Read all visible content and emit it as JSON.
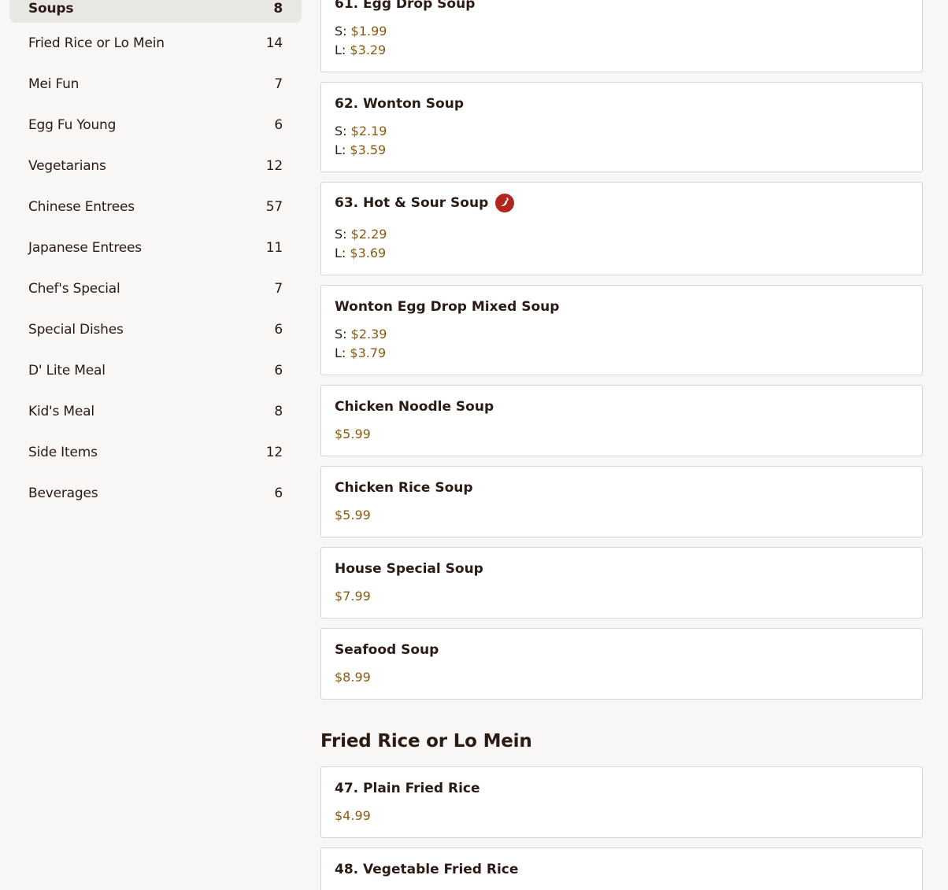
{
  "sidebar": {
    "items": [
      {
        "label": "Soups",
        "count": "8"
      },
      {
        "label": "Fried Rice or Lo Mein",
        "count": "14"
      },
      {
        "label": "Mei Fun",
        "count": "7"
      },
      {
        "label": "Egg Fu Young",
        "count": "6"
      },
      {
        "label": "Vegetarians",
        "count": "12"
      },
      {
        "label": "Chinese Entrees",
        "count": "57"
      },
      {
        "label": "Japanese Entrees",
        "count": "11"
      },
      {
        "label": "Chef's Special",
        "count": "7"
      },
      {
        "label": "Special Dishes",
        "count": "6"
      },
      {
        "label": "D' Lite Meal",
        "count": "6"
      },
      {
        "label": "Kid's Meal",
        "count": "8"
      },
      {
        "label": "Side Items",
        "count": "12"
      },
      {
        "label": "Beverages",
        "count": "6"
      }
    ]
  },
  "soups": {
    "items": [
      {
        "name": "61. Egg Drop Soup",
        "small_label": "S:",
        "small": "$1.99",
        "large_label": "L:",
        "large": "$3.29"
      },
      {
        "name": "62. Wonton Soup",
        "small_label": "S:",
        "small": "$2.19",
        "large_label": "L:",
        "large": "$3.59"
      },
      {
        "name": "63. Hot & Sour Soup",
        "spicy_icon": "chili-pepper-icon",
        "small_label": "S:",
        "small": "$2.29",
        "large_label": "L:",
        "large": "$3.69"
      },
      {
        "name": "Wonton Egg Drop Mixed Soup",
        "small_label": "S:",
        "small": "$2.39",
        "large_label": "L:",
        "large": "$3.79"
      },
      {
        "name": "Chicken Noodle Soup",
        "price": "$5.99"
      },
      {
        "name": "Chicken Rice Soup",
        "price": "$5.99"
      },
      {
        "name": "House Special Soup",
        "price": "$7.99"
      },
      {
        "name": "Seafood Soup",
        "price": "$8.99"
      }
    ]
  },
  "fried_rice": {
    "title": "Fried Rice or Lo Mein",
    "items": [
      {
        "name": "47. Plain Fried Rice",
        "price": "$4.99"
      },
      {
        "name": "48. Vegetable Fried Rice"
      }
    ]
  },
  "colors": {
    "price": "#8a5a10",
    "spicy": "#b1271e",
    "active_category_bg": "#e9e7e3"
  }
}
